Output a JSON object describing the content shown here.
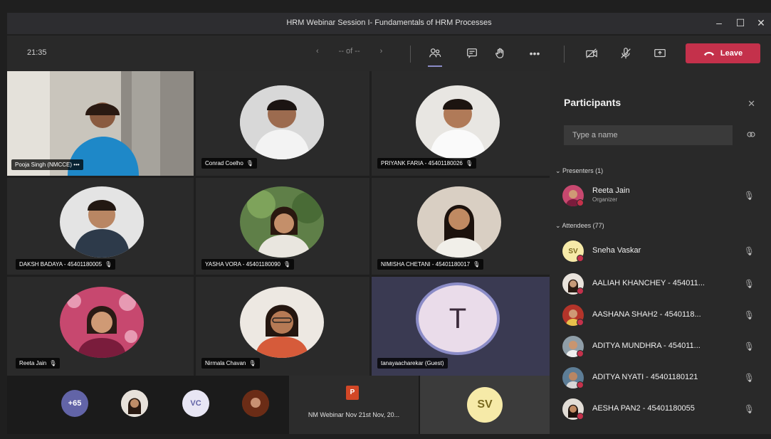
{
  "window": {
    "title": "HRM Webinar Session I- Fundamentals of HRM Processes",
    "minimize": "–",
    "maximize": "☐",
    "close": "✕"
  },
  "toolbar": {
    "clock": "21:35",
    "pager_prev": "‹",
    "pager_label": "-- of --",
    "pager_next": "›",
    "more": "•••",
    "leave_label": "Leave"
  },
  "tiles": [
    {
      "name": "Pooja Singh (NMCCE)",
      "suffix": "•••"
    },
    {
      "name": "Conrad Coelho",
      "suffix": "🎙"
    },
    {
      "name": "PRIYANK FARIA - 45401180026",
      "suffix": "🎙"
    },
    {
      "name": "DAKSH BADAYA - 45401180005",
      "suffix": "🎙"
    },
    {
      "name": "YASHA VORA - 45401180090",
      "suffix": "🎙"
    },
    {
      "name": "NIMISHA CHETANI - 45401180017",
      "suffix": "🎙"
    },
    {
      "name": "Reeta Jain",
      "suffix": "🎙"
    },
    {
      "name": "Nirmala Chavan",
      "suffix": "🎙"
    },
    {
      "name": "tanayaacharekar (Guest)",
      "suffix": "",
      "initial": "T"
    }
  ],
  "overflow": {
    "count": "+65",
    "vc": "VC",
    "sv": "SV",
    "file": "NM Webinar Nov 21st Nov, 20..."
  },
  "panel": {
    "title": "Participants",
    "close": "✕",
    "search_placeholder": "Type a name",
    "presenters_label": "Presenters (1)",
    "attendees_label": "Attendees (77)",
    "presenter": {
      "name": "Reeta Jain",
      "role": "Organizer"
    },
    "attendees": [
      {
        "name": "Sneha Vaskar",
        "initials": "SV"
      },
      {
        "name": "AALIAH KHANCHEY - 454011..."
      },
      {
        "name": "AASHANA SHAH2 - 4540118..."
      },
      {
        "name": "ADITYA MUNDHRA - 454011..."
      },
      {
        "name": "ADITYA NYATI - 45401180121"
      },
      {
        "name": "AESHA PAN2 - 45401180055"
      }
    ]
  },
  "colors": {
    "leave": "#c4314b",
    "accent": "#8b8cc7",
    "tile": "#2a2a2a",
    "panel": "#292929"
  }
}
